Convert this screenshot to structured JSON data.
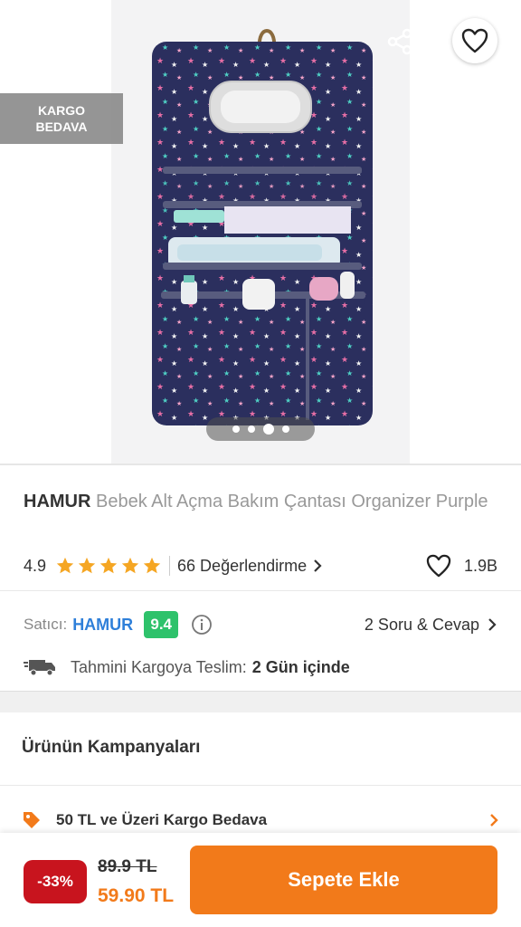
{
  "header": {
    "back_icon": "arrow-left-icon",
    "share_icon": "share-icon",
    "favorite_icon": "heart-outline-icon"
  },
  "badge": {
    "line1": "KARGO",
    "line2": "BEDAVA"
  },
  "gallery": {
    "image_count": 4,
    "active_index": 2
  },
  "product": {
    "brand": "HAMUR",
    "name": "Bebek Alt Açma Bakım Çantası Organizer Purple",
    "rating": "4.9",
    "stars": 5,
    "reviews_label": "66 Değerlendirme",
    "likes": "1.9B"
  },
  "seller": {
    "label": "Satıcı:",
    "name": "HAMUR",
    "score": "9.4",
    "qa_label": "2 Soru & Cevap"
  },
  "shipping": {
    "label": "Tahmini Kargoya Teslim:",
    "value": "2 Gün içinde"
  },
  "campaigns": {
    "title": "Ürünün Kampanyaları",
    "items": [
      {
        "text": "50 TL ve Üzeri Kargo Bedava",
        "icon": "tag-icon"
      }
    ]
  },
  "price": {
    "discount": "-33%",
    "old": "89.9 TL",
    "new": "59.90 TL",
    "add_to_cart": "Sepete Ekle"
  },
  "colors": {
    "accent": "#f27a1a",
    "discount_bg": "#c8141e",
    "seller_link": "#2e7fd9",
    "score_bg": "#2ec26b",
    "star": "#f5a623",
    "bag_navy": "#2b2f5e"
  }
}
